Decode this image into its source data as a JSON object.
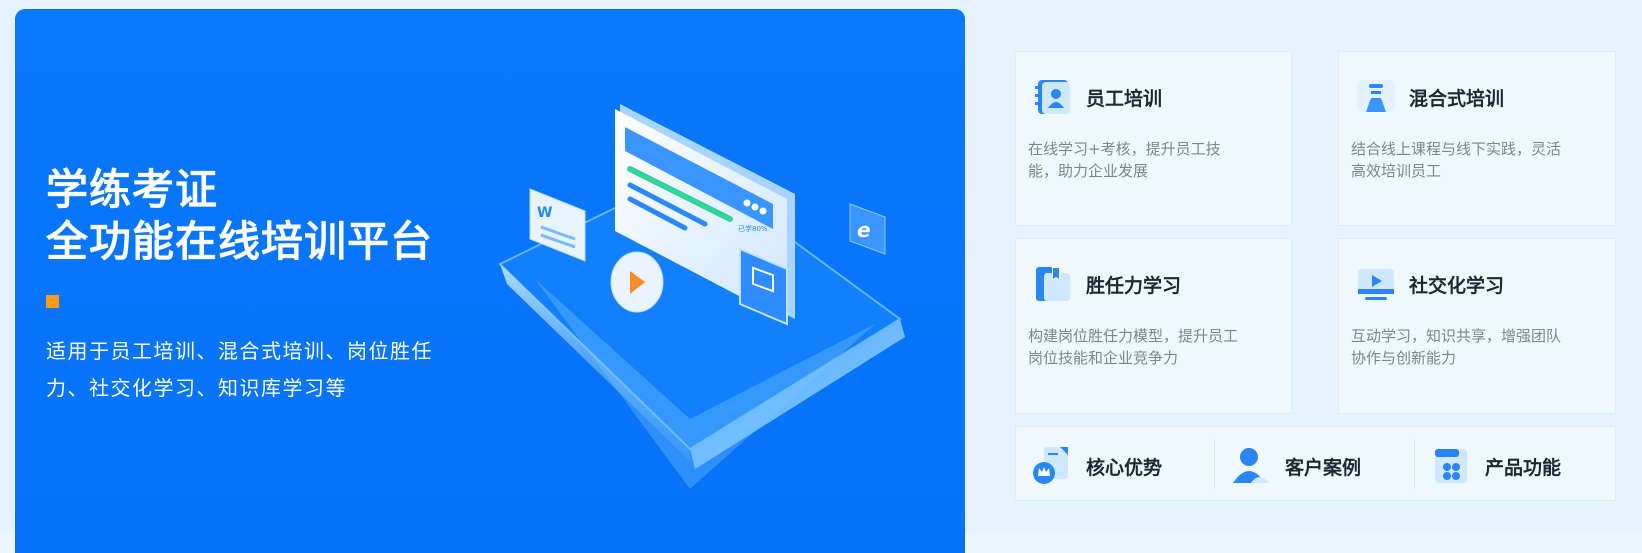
{
  "hero": {
    "title_line1": "学练考证",
    "title_line2": "全功能在线培训平台",
    "description": "适用于员工培训、混合式培训、岗位胜任力、社交化学习、知识库学习等",
    "illustration_progress_text": "已学80%",
    "accent_color": "#ff9a1a",
    "bg_color": "#0a78fb"
  },
  "cards": [
    {
      "title": "员工培训",
      "desc": "在线学习+考核，提升员工技能，助力企业发展",
      "icon": "employee-profile-icon"
    },
    {
      "title": "混合式培训",
      "desc": "结合线上课程与线下实践，灵活高效培训员工",
      "icon": "presenter-icon"
    },
    {
      "title": "胜任力学习",
      "desc": "构建岗位胜任力模型，提升员工岗位技能和企业竞争力",
      "icon": "document-bookmark-icon"
    },
    {
      "title": "社交化学习",
      "desc": "互动学习，知识共享，增强团队协作与创新能力",
      "icon": "monitor-play-icon"
    }
  ],
  "links": [
    {
      "label": "核心优势",
      "icon": "crown-badge-icon"
    },
    {
      "label": "客户案例",
      "icon": "user-icon"
    },
    {
      "label": "产品功能",
      "icon": "grid-box-icon"
    }
  ]
}
